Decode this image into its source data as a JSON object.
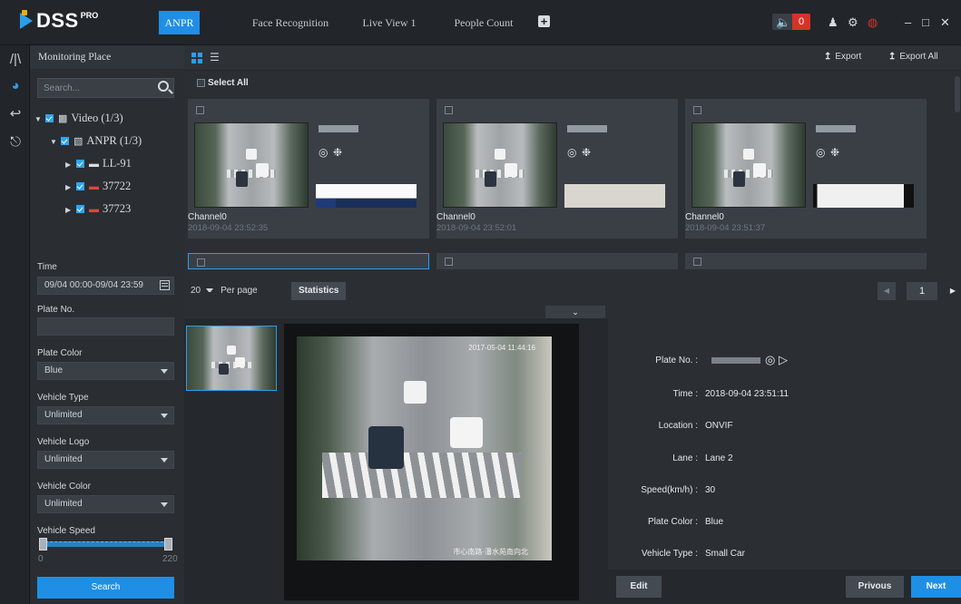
{
  "app": {
    "logo_text": "DSS",
    "logo_sup": "PRO"
  },
  "tabs": [
    {
      "label": "ANPR",
      "active": true
    },
    {
      "label": "Face Recognition",
      "active": false
    },
    {
      "label": "Live View 1",
      "active": false
    },
    {
      "label": "People Count",
      "active": false
    }
  ],
  "titlebar": {
    "alarm_count": "0",
    "icons": [
      "speaker-icon",
      "user-icon",
      "gear-icon",
      "gauge-icon",
      "minimize-icon",
      "maximize-icon",
      "close-icon"
    ]
  },
  "sidebar": {
    "title": "Monitoring Place",
    "search_placeholder": "Search...",
    "tree": [
      {
        "label": "Video (1/3)",
        "icon": "video-group-icon"
      },
      {
        "label": "ANPR (1/3)",
        "icon": "anpr-group-icon"
      },
      {
        "label": "LL-91",
        "icon": "camera-icon"
      },
      {
        "label": "37722",
        "icon": "anpr-camera-icon"
      },
      {
        "label": "37723",
        "icon": "anpr-camera-icon"
      }
    ],
    "filters": {
      "time_label": "Time",
      "time_value": "09/04 00:00-09/04 23:59",
      "plate_label": "Plate No.",
      "plate_value": "",
      "plate_color_label": "Plate Color",
      "plate_color_value": "Blue",
      "vehicle_type_label": "Vehicle Type",
      "vehicle_type_value": "Unlimited",
      "vehicle_logo_label": "Vehicle Logo",
      "vehicle_logo_value": "Unlimited",
      "vehicle_color_label": "Vehicle Color",
      "vehicle_color_value": "Unlimited",
      "vehicle_speed_label": "Vehicle Speed",
      "speed_min": "0",
      "speed_max": "220"
    },
    "search_button": "Search"
  },
  "toolbar": {
    "export_label": "Export",
    "export_all_label": "Export All",
    "select_all_label": "Select All"
  },
  "cards": [
    {
      "channel": "Channel0",
      "timestamp": "2018-09-04 23:52:35"
    },
    {
      "channel": "Channel0",
      "timestamp": "2018-09-04 23:52:01"
    },
    {
      "channel": "Channel0",
      "timestamp": "2018-09-04 23:51:37"
    }
  ],
  "pager": {
    "per_page_value": "20",
    "per_page_label": "Per page",
    "statistics_label": "Statistics",
    "current_page": "1"
  },
  "detail": {
    "osd_time": "2017-05-04 11:44:16",
    "osd_location": "市心南路·潘水苑南向北",
    "fields": [
      {
        "key": "Plate No. :",
        "value": ""
      },
      {
        "key": "Time :",
        "value": "2018-09-04 23:51:11"
      },
      {
        "key": "Location :",
        "value": "ONVIF"
      },
      {
        "key": "Lane :",
        "value": "Lane 2"
      },
      {
        "key": "Speed(km/h) :",
        "value": "30"
      },
      {
        "key": "Plate Color :",
        "value": "Blue"
      },
      {
        "key": "Vehicle Type :",
        "value": "Small Car"
      }
    ],
    "edit_label": "Edit",
    "previous_label": "Privous",
    "next_label": "Next"
  },
  "colors": {
    "accent": "#1e8fe5",
    "background": "#1f2226",
    "panel": "#2a2e33",
    "alarm": "#d7322a"
  }
}
